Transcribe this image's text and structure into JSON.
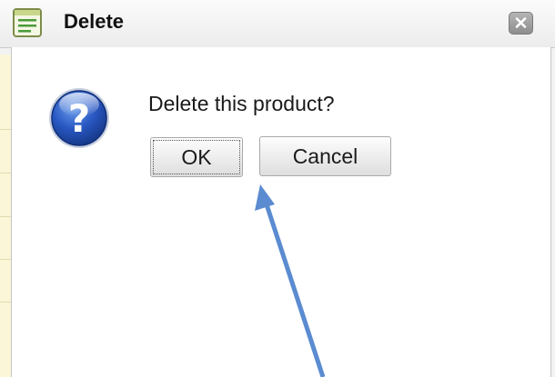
{
  "window": {
    "title": "Delete",
    "icon": "form-icon",
    "close_icon": "close-icon"
  },
  "dialog": {
    "message": "Delete this product?",
    "icon": "question-icon",
    "buttons": {
      "ok_label": "OK",
      "cancel_label": "Cancel"
    }
  },
  "annotation": {
    "arrow_color": "#5b8bd0",
    "points_to": "ok-button"
  },
  "colors": {
    "question_icon": "#1f4fb6",
    "background_strip": "#fbf6d8"
  }
}
